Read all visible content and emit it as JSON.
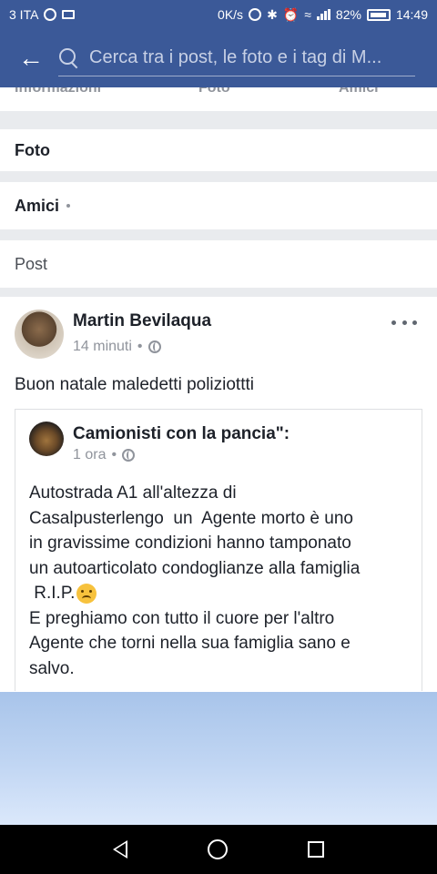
{
  "status_bar": {
    "carrier": "3 ITA",
    "speed": "0K/s",
    "battery": "82%",
    "time": "14:49"
  },
  "header": {
    "search_placeholder": "Cerca tra i post, le foto e i tag di M..."
  },
  "profile_tabs_cut": [
    "Informazioni",
    "Foto",
    "Amici"
  ],
  "sections": {
    "photos": "Foto",
    "friends": "Amici",
    "posts": "Post"
  },
  "post": {
    "author": "Martin Bevilaqua",
    "time": "14 minuti",
    "visibility_icon": "globe-icon",
    "text": "Buon natale maledetti poliziottti",
    "shared": {
      "author": "Camionisti con la pancia\":",
      "time": "1 ora",
      "line1": "Autostrada A1 all'altezza di",
      "line2": "Casalpusterlengo  un  Agente morto è uno",
      "line3": "in gravissime condizioni hanno tamponato",
      "line4": "un autoarticolato condoglianze alla famiglia",
      "line5": " R.I.P.",
      "line6": "E preghiamo con tutto il cuore per l'altro",
      "line7": "Agente che torni nella sua famiglia sano e",
      "line8": "salvo."
    }
  },
  "colors": {
    "brand": "#3b5998",
    "background": "#e9ebee"
  }
}
